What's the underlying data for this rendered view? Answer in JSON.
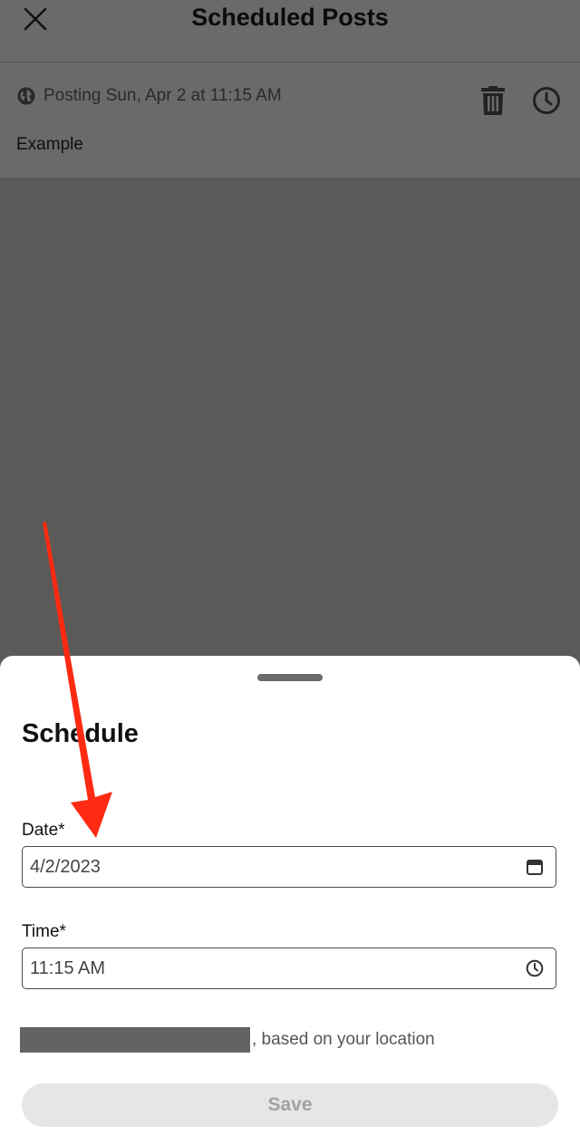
{
  "header": {
    "title": "Scheduled Posts",
    "close_icon": "close-icon"
  },
  "post": {
    "visibility_icon": "globe-icon",
    "meta": "Posting Sun, Apr 2 at 11:15 AM",
    "text": "Example",
    "delete_icon": "trash-icon",
    "reschedule_icon": "clock-icon"
  },
  "sheet": {
    "title": "Schedule",
    "date": {
      "label": "Date*",
      "value": "4/2/2023",
      "icon": "calendar-icon"
    },
    "time": {
      "label": "Time*",
      "value": "11:15 AM",
      "icon": "clock-icon"
    },
    "timezone_suffix": ", based on your location",
    "save_label": "Save"
  },
  "annotation": {
    "color": "#ff2a12",
    "icon": "red-arrow-pointing-to-date-field"
  },
  "colors": {
    "overlay": "#5b5a58",
    "header_bg": "#6a6a6a",
    "sheet_bg": "#ffffff",
    "save_disabled_bg": "#e6e6e6",
    "save_disabled_text": "#a2a2a2"
  }
}
